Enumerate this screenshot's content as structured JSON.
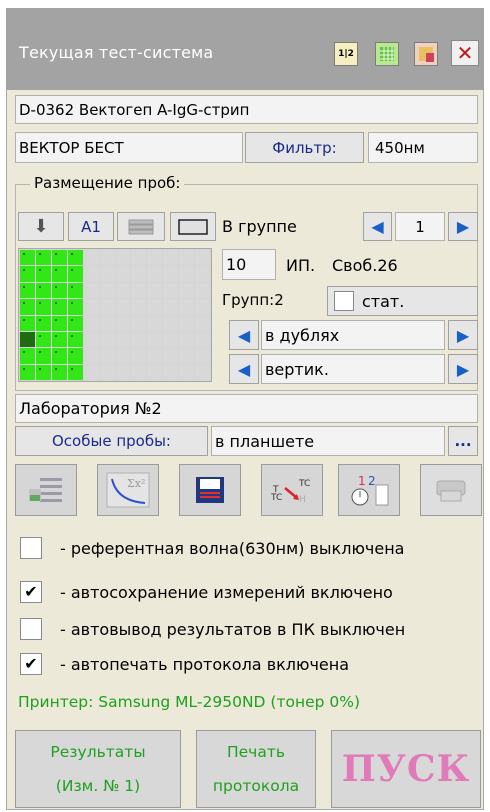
{
  "window": {
    "title": "Текущая тест-система",
    "icons": [
      "one-two-icon",
      "grid-green-icon",
      "help-icon",
      "close-icon"
    ],
    "icon_text": "1|2"
  },
  "test": {
    "name": "D-0362 Вектогеп A-IgG-стрип",
    "manufacturer": "ВЕКТОР БЕСТ",
    "filter_label": "Фильтр:",
    "filter_value": "450нм"
  },
  "placement": {
    "title": "Размещение проб:",
    "a1_label": "A1",
    "in_group_label": "В группе",
    "in_group_value": "1",
    "ip_value": "10",
    "ip_label": "ИП.",
    "free_label": "Своб.26",
    "groups_label": "Групп:2",
    "stat_label": "стат.",
    "mode": "в дублях",
    "direction": "вертик.",
    "lab": "Лаборатория №2",
    "special_label": "Особые пробы:",
    "special_value": "в планшете",
    "more_label": "...",
    "plate": {
      "cols": 12,
      "rows": 8,
      "filled_columns": 4,
      "highlight": {
        "row": 5,
        "col": 0
      }
    }
  },
  "options": [
    {
      "checked": false,
      "label": "- референтная волна(630нм) выключена"
    },
    {
      "checked": true,
      "label": "- автосохранение измерений включено"
    },
    {
      "checked": false,
      "label": "- автовывод результатов в ПК выключен"
    },
    {
      "checked": true,
      "label": "- автопечать протокола включена"
    }
  ],
  "printer": "Принтер: Samsung ML-2950ND (тонер 0%)",
  "buttons": {
    "results_line1": "Результаты",
    "results_line2": "(Изм. № 1)",
    "print_line1": "Печать",
    "print_line2": "протокола",
    "start": "ПУСК"
  },
  "colors": {
    "accent_green": "#1ea01e",
    "plate_green": "#33e617",
    "start_pink": "#e07ab8",
    "arrow_blue": "#1860c8"
  }
}
